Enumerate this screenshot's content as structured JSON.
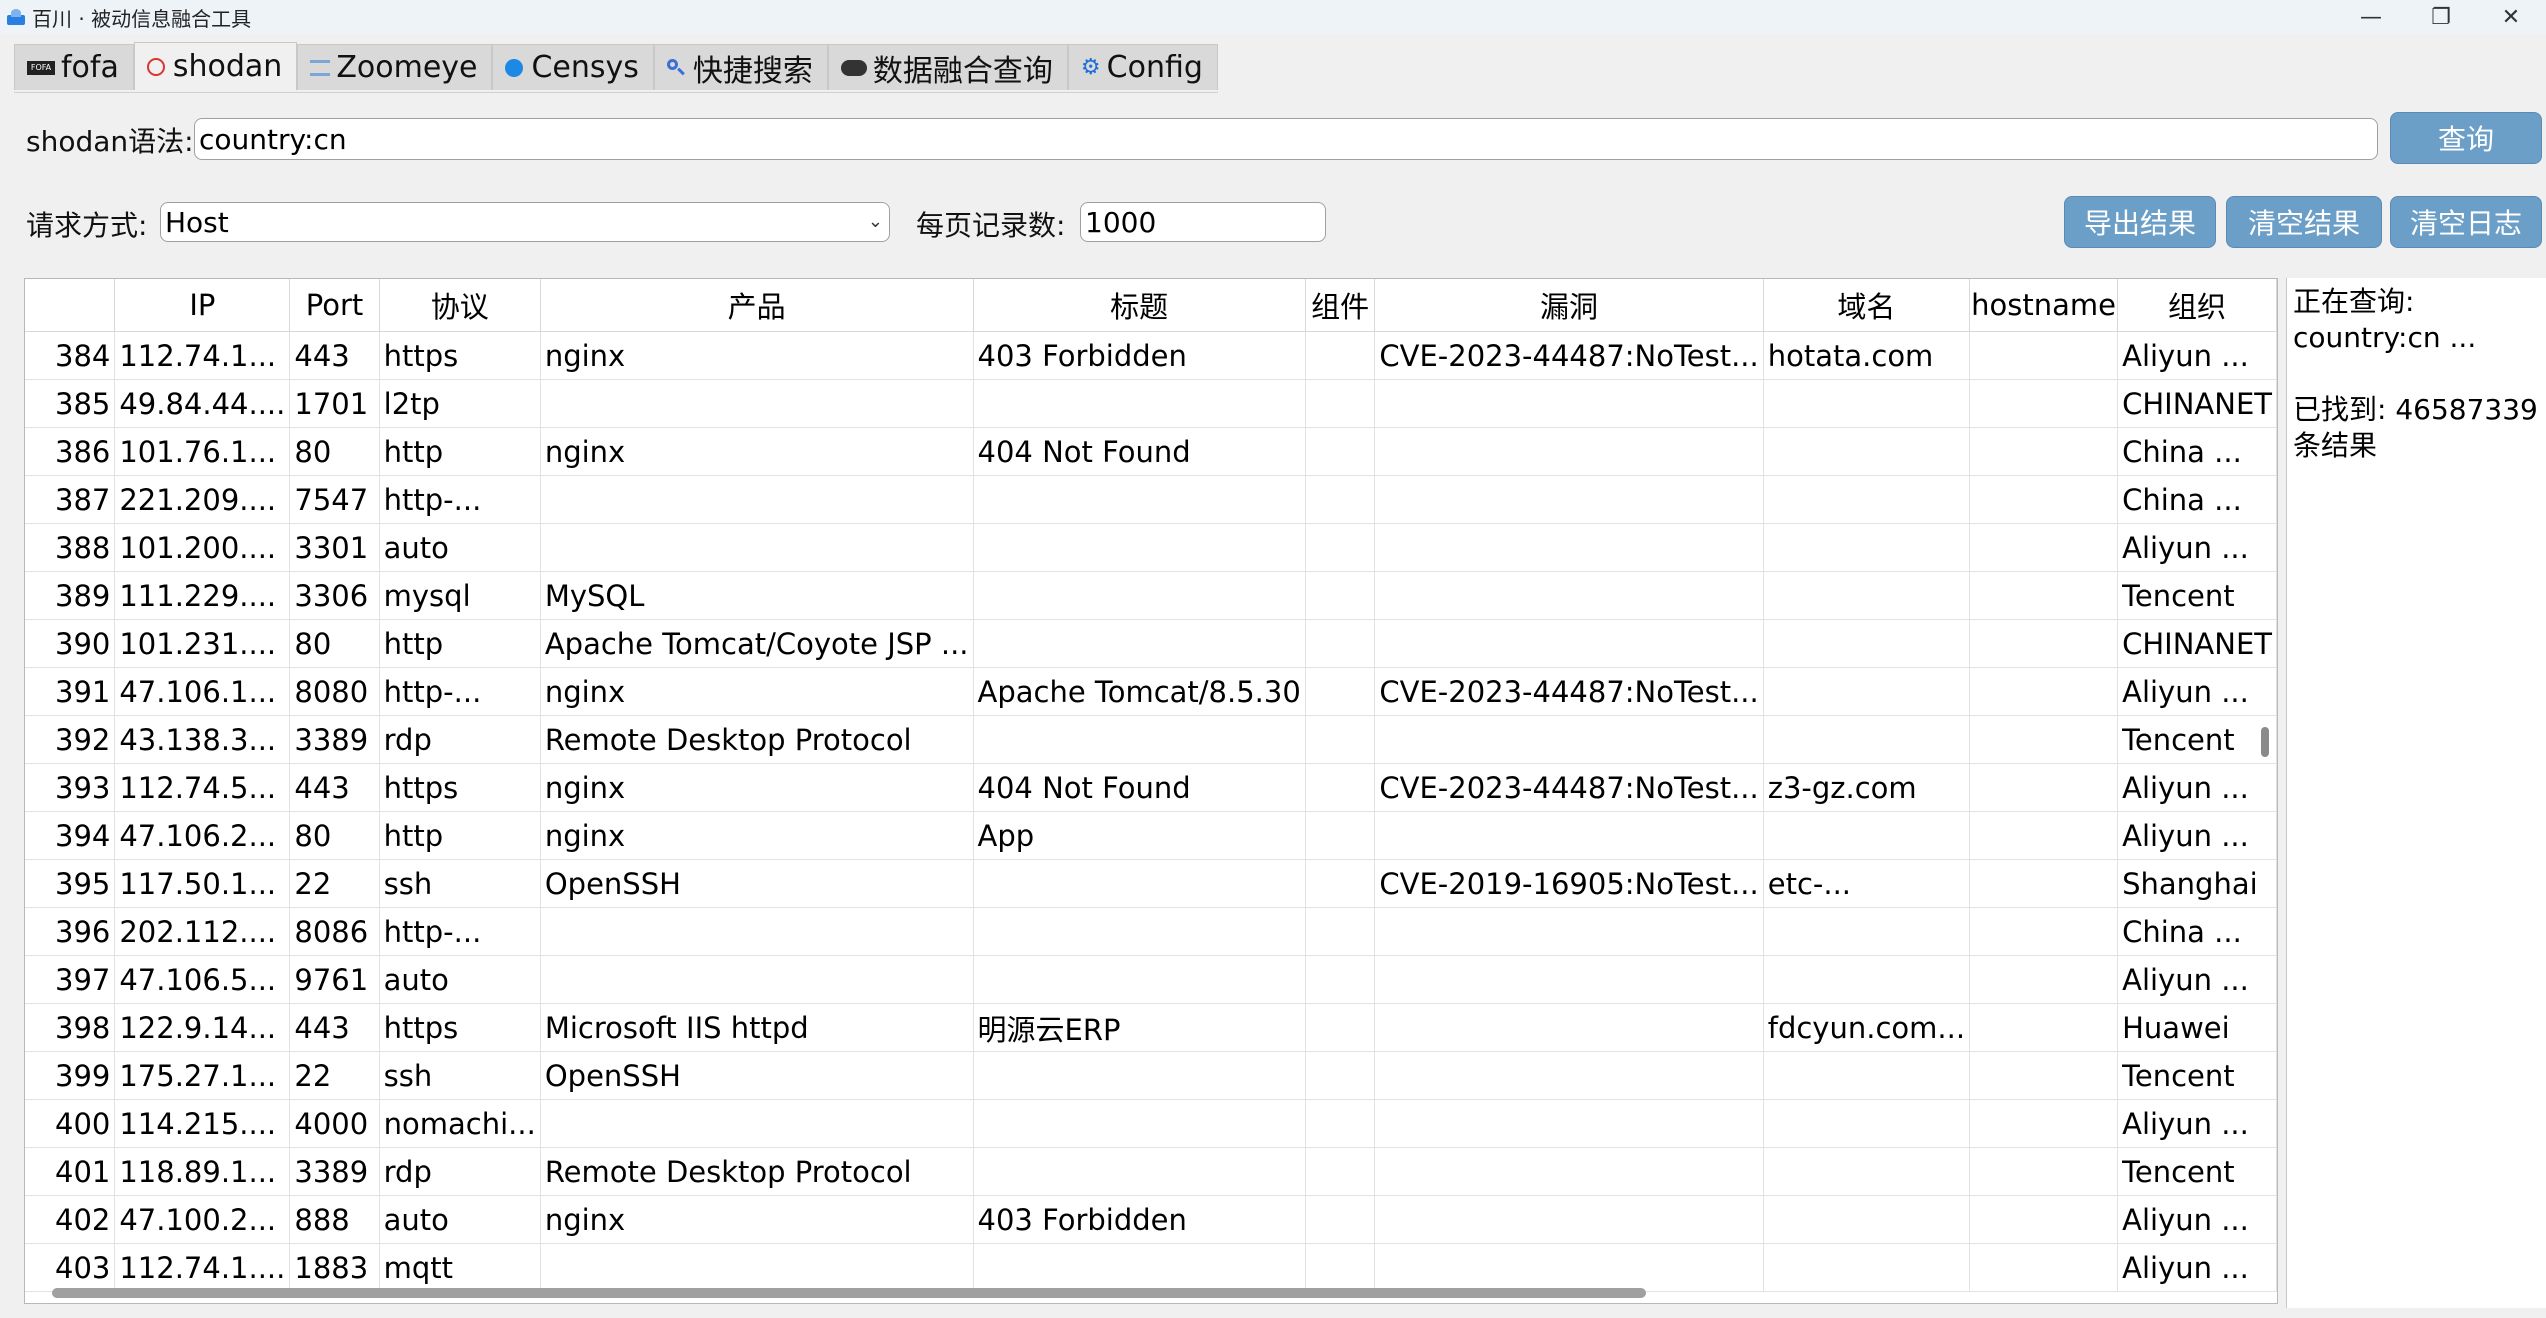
{
  "window": {
    "title": "百川 · 被动信息融合工具",
    "controls": [
      "minimize",
      "restore",
      "close"
    ]
  },
  "tabs": [
    {
      "label": "fofa",
      "icon": "fofa-icon",
      "active": false
    },
    {
      "label": "shodan",
      "icon": "shodan-icon",
      "active": true
    },
    {
      "label": "Zoomeye",
      "icon": "zoomeye-icon",
      "active": false
    },
    {
      "label": "Censys",
      "icon": "censys-icon",
      "active": false
    },
    {
      "label": "快捷搜索",
      "icon": "search-icon",
      "active": false
    },
    {
      "label": "数据融合查询",
      "icon": "cloud-icon",
      "active": false
    },
    {
      "label": "Config",
      "icon": "gear-icon",
      "active": false
    }
  ],
  "query": {
    "label": "shodan语法:",
    "value": "country:cn",
    "button": "查询"
  },
  "options": {
    "method_label": "请求方式:",
    "method_value": "Host",
    "per_page_label": "每页记录数:",
    "per_page_value": "1000",
    "export_button": "导出结果",
    "clear_results_button": "清空结果",
    "clear_log_button": "清空日志"
  },
  "table": {
    "columns": [
      "",
      "IP",
      "Port",
      "协议",
      "产品",
      "标题",
      "组件",
      "漏洞",
      "域名",
      "hostname",
      "组织"
    ],
    "rows": [
      [
        "384",
        "112.74.1...",
        "443",
        "https",
        "nginx",
        "403 Forbidden",
        "",
        "CVE-2023-44487:NoTest...",
        "hotata.com",
        "",
        "Aliyun ..."
      ],
      [
        "385",
        "49.84.44....",
        "1701",
        "l2tp",
        "",
        "",
        "",
        "",
        "",
        "",
        "CHINANET"
      ],
      [
        "386",
        "101.76.1...",
        "80",
        "http",
        "nginx",
        "404 Not Found",
        "",
        "",
        "",
        "",
        "China ..."
      ],
      [
        "387",
        "221.209....",
        "7547",
        "http-...",
        "",
        "",
        "",
        "",
        "",
        "",
        "China ..."
      ],
      [
        "388",
        "101.200....",
        "3301",
        "auto",
        "",
        "",
        "",
        "",
        "",
        "",
        "Aliyun ..."
      ],
      [
        "389",
        "111.229....",
        "3306",
        "mysql",
        "MySQL",
        "",
        "",
        "",
        "",
        "",
        "Tencent"
      ],
      [
        "390",
        "101.231....",
        "80",
        "http",
        "Apache Tomcat/Coyote JSP ...",
        "",
        "",
        "",
        "",
        "",
        "CHINANET"
      ],
      [
        "391",
        "47.106.1...",
        "8080",
        "http-...",
        "nginx",
        "Apache Tomcat/8.5.30",
        "",
        "CVE-2023-44487:NoTest...",
        "",
        "",
        "Aliyun ..."
      ],
      [
        "392",
        "43.138.3...",
        "3389",
        "rdp",
        "Remote Desktop Protocol",
        "",
        "",
        "",
        "",
        "",
        "Tencent"
      ],
      [
        "393",
        "112.74.5...",
        "443",
        "https",
        "nginx",
        "404 Not Found",
        "",
        "CVE-2023-44487:NoTest...",
        "z3-gz.com",
        "",
        "Aliyun ..."
      ],
      [
        "394",
        "47.106.2...",
        "80",
        "http",
        "nginx",
        "App",
        "",
        "",
        "",
        "",
        "Aliyun ..."
      ],
      [
        "395",
        "117.50.1...",
        "22",
        "ssh",
        "OpenSSH",
        "",
        "",
        "CVE-2019-16905:NoTest...",
        "etc-...",
        "",
        "Shanghai"
      ],
      [
        "396",
        "202.112....",
        "8086",
        "http-...",
        "",
        "",
        "",
        "",
        "",
        "",
        "China ..."
      ],
      [
        "397",
        "47.106.5...",
        "9761",
        "auto",
        "",
        "",
        "",
        "",
        "",
        "",
        "Aliyun ..."
      ],
      [
        "398",
        "122.9.14...",
        "443",
        "https",
        "Microsoft IIS httpd",
        "明源云ERP",
        "",
        "",
        "fdcyun.com...",
        "",
        "Huawei"
      ],
      [
        "399",
        "175.27.1...",
        "22",
        "ssh",
        "OpenSSH",
        "",
        "",
        "",
        "",
        "",
        "Tencent"
      ],
      [
        "400",
        "114.215....",
        "4000",
        "nomachi...",
        "",
        "",
        "",
        "",
        "",
        "",
        "Aliyun ..."
      ],
      [
        "401",
        "118.89.1...",
        "3389",
        "rdp",
        "Remote Desktop Protocol",
        "",
        "",
        "",
        "",
        "",
        "Tencent"
      ],
      [
        "402",
        "47.100.2...",
        "888",
        "auto",
        "nginx",
        "403 Forbidden",
        "",
        "",
        "",
        "",
        "Aliyun ..."
      ],
      [
        "403",
        "112.74.1....",
        "1883",
        "mqtt",
        "",
        "",
        "",
        "",
        "",
        "",
        "Aliyun ..."
      ]
    ]
  },
  "log": {
    "lines": [
      "正在查询:",
      "country:cn ...",
      "",
      "已找到: 46587339",
      "条结果"
    ]
  }
}
